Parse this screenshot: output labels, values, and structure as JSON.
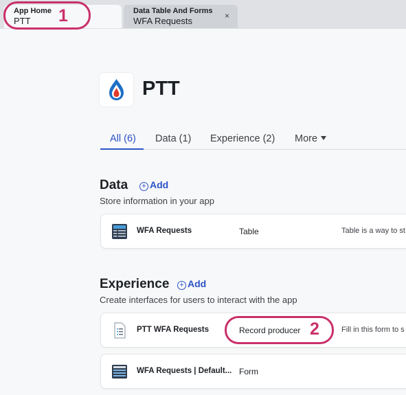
{
  "tabs": [
    {
      "title": "App Home",
      "subtitle": "PTT"
    },
    {
      "title": "Data Table And Forms",
      "subtitle": "WFA Requests",
      "close": "×"
    }
  ],
  "annotations": {
    "one": "1",
    "two": "2"
  },
  "app": {
    "name": "PTT",
    "logo_icon": "ptt-flame-logo"
  },
  "filter_tabs": [
    {
      "label": "All (6)",
      "selected": true
    },
    {
      "label": "Data (1)"
    },
    {
      "label": "Experience (2)"
    },
    {
      "label": "More"
    }
  ],
  "sections": {
    "data": {
      "title": "Data",
      "add_label": "Add",
      "subtitle": "Store information in your app",
      "items": [
        {
          "name": "WFA Requests",
          "type": "Table",
          "desc": "Table is a way to st",
          "icon": "table-icon"
        }
      ]
    },
    "experience": {
      "title": "Experience",
      "add_label": "Add",
      "subtitle": "Create interfaces for users to interact with the app",
      "items": [
        {
          "name": "PTT WFA Requests",
          "type": "Record producer",
          "desc": "Fill in this form to s",
          "icon": "record-producer-icon"
        },
        {
          "name": "WFA Requests | Default...",
          "type": "Form",
          "desc": "",
          "icon": "form-icon"
        }
      ]
    }
  },
  "colors": {
    "accent": "#2b52c6",
    "annotation": "#c9306a",
    "logo_blue": "#1f6fc5",
    "logo_red": "#e23a2a"
  }
}
